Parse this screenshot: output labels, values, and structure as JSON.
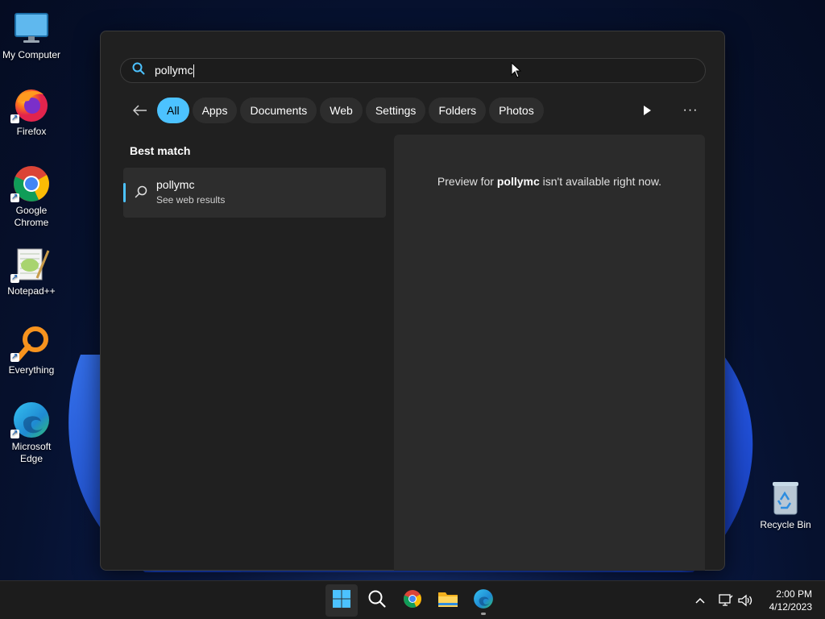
{
  "desktop": {
    "icons": [
      {
        "label": "My Computer",
        "icon": "monitor-icon",
        "shortcut": false
      },
      {
        "label": "Firefox",
        "icon": "firefox-icon",
        "shortcut": true
      },
      {
        "label": "Google Chrome",
        "icon": "chrome-icon",
        "shortcut": true
      },
      {
        "label": "Notepad++",
        "icon": "notepadpp-icon",
        "shortcut": true
      },
      {
        "label": "Everything",
        "icon": "everything-icon",
        "shortcut": true
      },
      {
        "label": "Microsoft Edge",
        "icon": "edge-icon",
        "shortcut": true
      }
    ],
    "recycle_bin": {
      "label": "Recycle Bin",
      "icon": "recycle-bin-icon"
    }
  },
  "search": {
    "query": "pollymc",
    "filters": [
      "All",
      "Apps",
      "Documents",
      "Web",
      "Settings",
      "Folders",
      "Photos"
    ],
    "active_filter": "All",
    "best_match_heading": "Best match",
    "result": {
      "title": "pollymc",
      "subtitle": "See web results"
    },
    "preview": {
      "prefix": "Preview for ",
      "term": "pollymc",
      "suffix": " isn't available right now."
    }
  },
  "taskbar": {
    "apps": [
      "start-icon",
      "search-icon",
      "chrome-icon",
      "file-explorer-icon",
      "edge-icon"
    ],
    "clock": {
      "time": "2:00 PM",
      "date": "4/12/2023"
    }
  },
  "colors": {
    "accent": "#4cc2ff",
    "panel": "#202020",
    "preview_bg": "#2b2b2b",
    "taskbar": "#1c1c1c"
  }
}
